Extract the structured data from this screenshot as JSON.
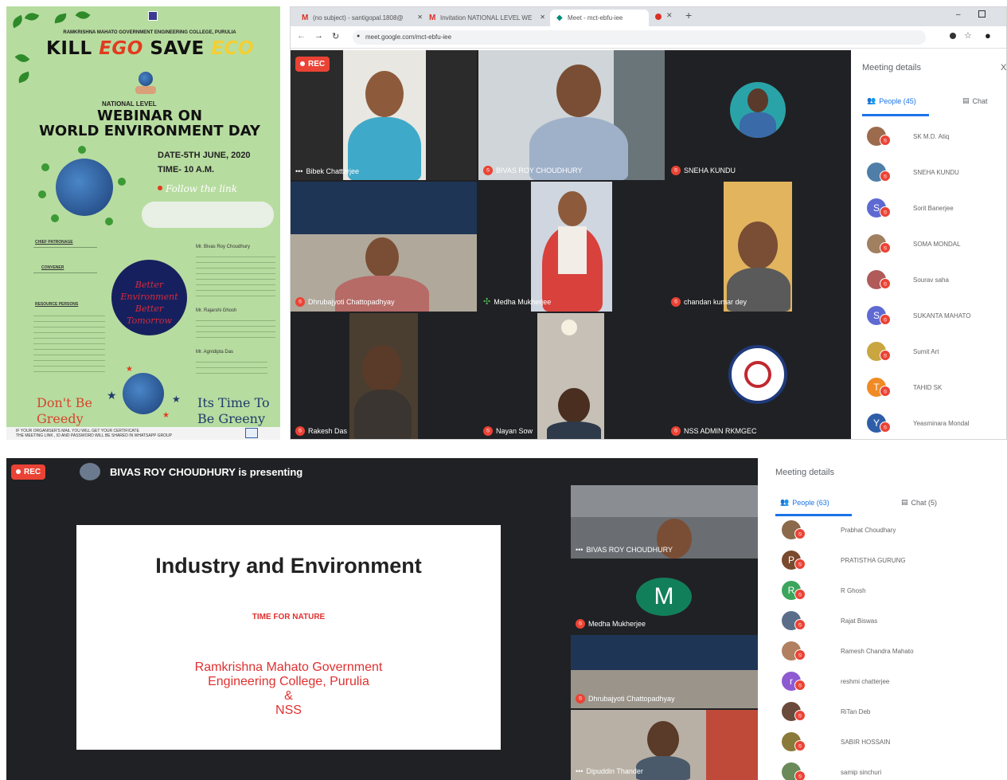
{
  "poster": {
    "college": "RAMKRISHNA MAHATO GOVERNMENT ENGINEERING COLLEGE, PURULIA",
    "headline": {
      "kill": "KILL",
      "ego": "EGO",
      "save": "SAVE",
      "eco": "ECO"
    },
    "national_level": "NATIONAL LEVEL",
    "webinar_line1": "WEBINAR ON",
    "webinar_line2": "WORLD ENVIRONMENT DAY",
    "date": "DATE-5TH JUNE, 2020",
    "time": "TIME- 10 A.M.",
    "follow": "Follow the link",
    "circle_text": "Better Environment Better Tomorrow",
    "chief_patronage": "CHIEF PATRONAGE",
    "convener": "CONVENER",
    "resource_persons": "RESOURCE PERSONS",
    "speaker1": "Mr. Bivas Roy Choudhury",
    "speaker2": "Mr. Rajarshi Ghosh",
    "speaker3": "Mr. Agnidipta Das",
    "dont_be_line1": "Don't Be",
    "dont_be_line2": "Greedy",
    "its_time_line1": "Its Time To",
    "its_time_line2": "Be Greeny",
    "footer_line1": "IF YOUR ORGANISER'S MAIL YOU WILL GET YOUR CERTIFICATE",
    "footer_line2": "THE MEETING LINK , ID AND PASSWORD WILL BE SHARED IN WHATSAPP GROUP"
  },
  "browser": {
    "tabs": [
      {
        "icon": "M",
        "label": "(no subject) - santigopal.1808@"
      },
      {
        "icon": "M",
        "label": "Invitation NATIONAL LEVEL WE"
      },
      {
        "icon": "◆",
        "label": "Meet - mct-ebfu-iee"
      }
    ],
    "new_tab": "+",
    "url": "meet.google.com/mct-ebfu-iee",
    "rec_label": "REC",
    "tiles": [
      {
        "name": "Bibek Chatterjee"
      },
      {
        "name": "BIVAS ROY CHOUDHURY"
      },
      {
        "name": "SNEHA KUNDU"
      },
      {
        "name": "Dhrubajyoti Chattopadhyay"
      },
      {
        "name": "Medha Mukherjee"
      },
      {
        "name": "chandan kumar dey"
      },
      {
        "name": "Rakesh Das"
      },
      {
        "name": "Nayan Sow"
      },
      {
        "name": "NSS ADMIN RKMGEC"
      }
    ],
    "sidebar": {
      "title": "Meeting details",
      "close": "X",
      "people_tab": "People (45)",
      "chat_tab": "Chat",
      "people": [
        {
          "name": "SK M.D. Atiq",
          "initial": "",
          "color": "#9c6b4e"
        },
        {
          "name": "SNEHA KUNDU",
          "initial": "",
          "color": "#4f7ea8"
        },
        {
          "name": "Sorit Banerjee",
          "initial": "S",
          "color": "#5e6ad2"
        },
        {
          "name": "SOMA MONDAL",
          "initial": "",
          "color": "#a08060"
        },
        {
          "name": "Sourav saha",
          "initial": "",
          "color": "#b05a5a"
        },
        {
          "name": "SUKANTA MAHATO",
          "initial": "S",
          "color": "#5e6ad2"
        },
        {
          "name": "Sumit Art",
          "initial": "",
          "color": "#c9a640"
        },
        {
          "name": "TAHID SK",
          "initial": "T",
          "color": "#f08a24"
        },
        {
          "name": "Yeasminara Mondal",
          "initial": "Y",
          "color": "#2f5ea8"
        }
      ]
    }
  },
  "presentation": {
    "rec_label": "REC",
    "presenting": "BIVAS ROY CHOUDHURY is presenting",
    "slide": {
      "title": "Industry and Environment",
      "subtitle": "TIME FOR NATURE",
      "line1": "Ramkrishna Mahato Government",
      "line2": "Engineering College, Purulia",
      "line3": "&",
      "line4": "NSS"
    },
    "right_tiles": [
      {
        "name": "BIVAS ROY CHOUDHURY"
      },
      {
        "name": "Medha Mukherjee",
        "initial": "M"
      },
      {
        "name": "Dhrubajyoti Chattopadhyay"
      },
      {
        "name": "Dipuddin Thander"
      }
    ]
  },
  "sidebar2": {
    "title": "Meeting details",
    "people_tab": "People (63)",
    "chat_tab": "Chat (5)",
    "people": [
      {
        "name": "Prabhat Choudhary",
        "initial": "",
        "color": "#8a6a4a"
      },
      {
        "name": "PRATISTHA GURUNG",
        "initial": "P",
        "color": "#7a4a2e"
      },
      {
        "name": "R Ghosh",
        "initial": "R",
        "color": "#3ba55c"
      },
      {
        "name": "Rajat Biswas",
        "initial": "",
        "color": "#5a6e8a"
      },
      {
        "name": "Ramesh Chandra Mahato",
        "initial": "",
        "color": "#b08060"
      },
      {
        "name": "reshmi chatterjee",
        "initial": "r",
        "color": "#8e5ad2"
      },
      {
        "name": "RiTan Deb",
        "initial": "",
        "color": "#6a4a3a"
      },
      {
        "name": "SABIR HOSSAIN",
        "initial": "",
        "color": "#8a7a3a"
      },
      {
        "name": "samip sinchuri",
        "initial": "",
        "color": "#6a8a5a"
      }
    ]
  }
}
